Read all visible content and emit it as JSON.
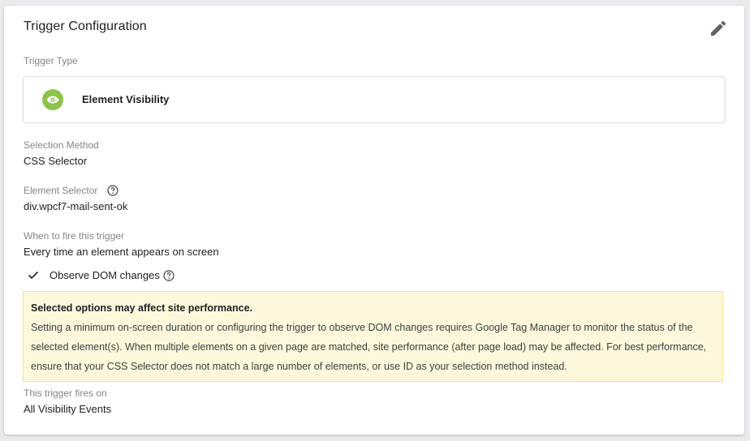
{
  "card": {
    "title": "Trigger Configuration",
    "edit_icon": "pencil-icon"
  },
  "trigger_type": {
    "label": "Trigger Type",
    "name": "Element Visibility",
    "icon": "eye-icon",
    "icon_color": "#8bc34a"
  },
  "selection_method": {
    "label": "Selection Method",
    "value": "CSS Selector"
  },
  "element_selector": {
    "label": "Element Selector",
    "value": "div.wpcf7-mail-sent-ok"
  },
  "when_to_fire": {
    "label": "When to fire this trigger",
    "value": "Every time an element appears on screen"
  },
  "observe_dom": {
    "label": "Observe DOM changes",
    "checked": true
  },
  "warning": {
    "title": "Selected options may affect site performance.",
    "body": "Setting a minimum on-screen duration or configuring the trigger to observe DOM changes requires Google Tag Manager to monitor the status of the selected element(s). When multiple elements on a given page are matched, site performance (after page load) may be affected. For best performance, ensure that your CSS Selector does not match a large number of elements, or use ID as your selection method instead.",
    "background": "#fdf8dc",
    "border": "#f3e38b"
  },
  "fires_on": {
    "label": "This trigger fires on",
    "value": "All Visibility Events"
  }
}
